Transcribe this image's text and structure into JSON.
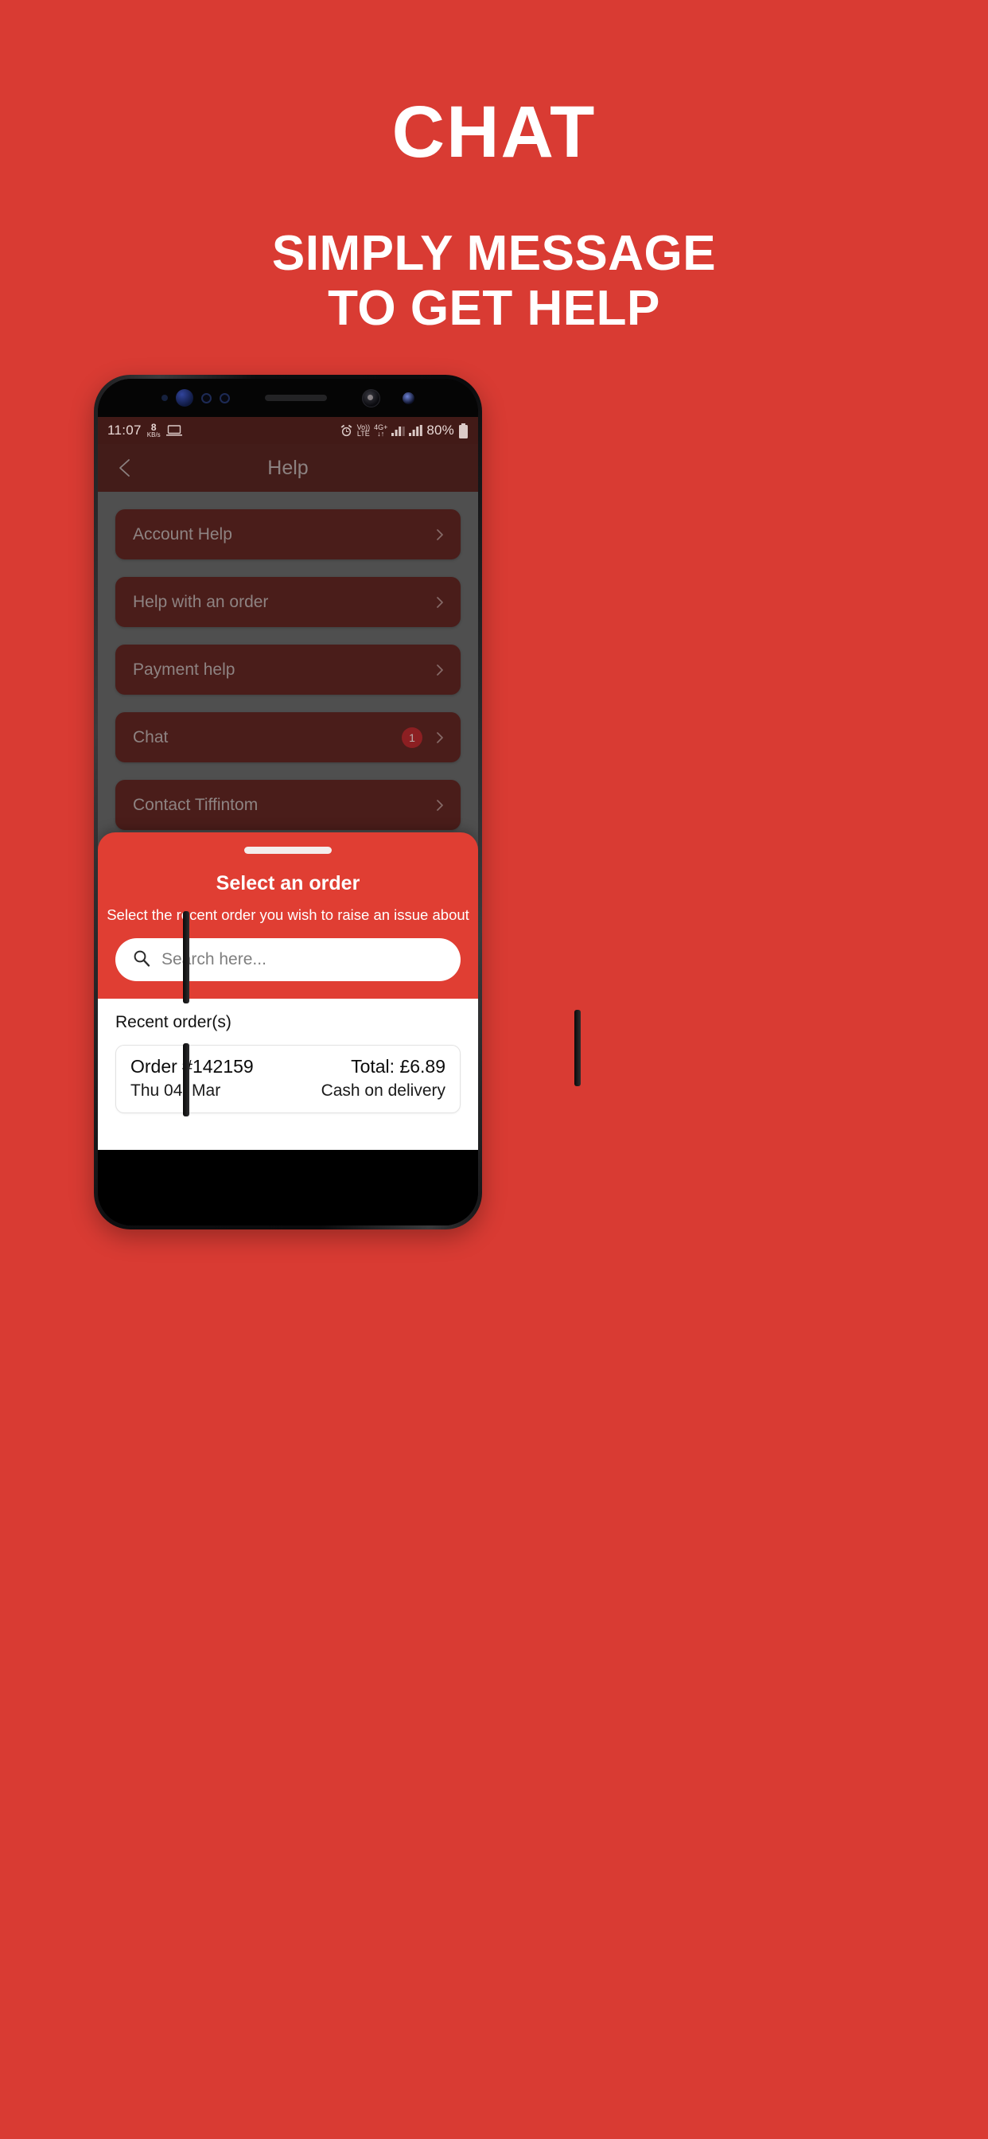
{
  "promo": {
    "title": "CHAT",
    "subtitle_line1": "SIMPLY MESSAGE",
    "subtitle_line2": "TO GET HELP",
    "background_color": "#D93B33",
    "text_color": "#FFFFFF"
  },
  "statusbar": {
    "time": "11:07",
    "data_rate_value": "8",
    "data_rate_unit": "KB/s",
    "laptop_icon": "laptop-icon",
    "alarm_icon": "alarm-clock-icon",
    "volte_line1": "Vo))",
    "volte_line2": "LTE",
    "network_line1": "4G+",
    "network_line2": "↓↑",
    "signal1_icon": "signal-bars-icon",
    "signal2_icon": "signal-bars-icon",
    "battery_percent": "80%",
    "battery_icon": "battery-icon",
    "background_color": "#421A17"
  },
  "appbar": {
    "back_icon": "back-chevron-icon",
    "title": "Help",
    "background_color": "#431C19",
    "title_color": "#8C8180"
  },
  "help_list": {
    "items": [
      {
        "label": "Account Help",
        "badge": "",
        "chevron": "chevron-right-icon"
      },
      {
        "label": "Help with an order",
        "badge": "",
        "chevron": "chevron-right-icon"
      },
      {
        "label": "Payment help",
        "badge": "",
        "chevron": "chevron-right-icon"
      },
      {
        "label": "Chat",
        "badge": "1",
        "chevron": "chevron-right-icon"
      },
      {
        "label": "Contact Tiffintom",
        "badge": "",
        "chevron": "chevron-right-icon"
      }
    ]
  },
  "sheet": {
    "grabber": "drag-handle",
    "title": "Select an order",
    "subtitle": "Select the recent order you wish to raise an issue about",
    "search_placeholder": "Search here...",
    "search_value": "",
    "search_icon": "search-icon",
    "accent_color": "#E03E33",
    "recent_orders_heading": "Recent order(s)",
    "orders": [
      {
        "order_number": "Order #142159",
        "date": "Thu 04, Mar",
        "total": "Total: £6.89",
        "payment_method": "Cash on delivery"
      }
    ]
  }
}
